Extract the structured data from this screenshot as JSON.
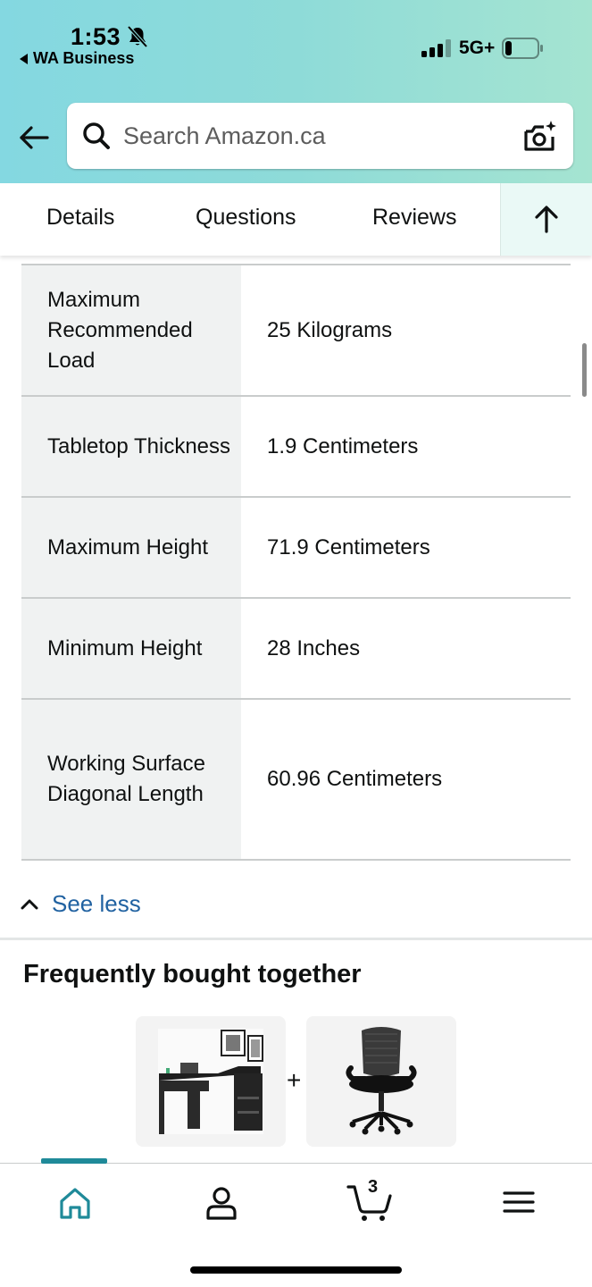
{
  "status_bar": {
    "time": "1:53",
    "back_app": "WA Business",
    "network": "5G+"
  },
  "search": {
    "placeholder": "Search Amazon.ca"
  },
  "tabs": [
    {
      "label": "Details"
    },
    {
      "label": "Questions"
    },
    {
      "label": "Reviews"
    }
  ],
  "specs": [
    {
      "key": "Maximum Recommended Load",
      "value": "25 Kilograms"
    },
    {
      "key": "Tabletop Thickness",
      "value": "1.9 Centimeters"
    },
    {
      "key": "Maximum Height",
      "value": "71.9 Centimeters"
    },
    {
      "key": "Minimum Height",
      "value": "28 Inches"
    },
    {
      "key": "Working Surface Diagonal Length",
      "value": "60.96 Centimeters"
    }
  ],
  "see_less_label": "See less",
  "frequently_bought": {
    "title": "Frequently bought together",
    "plus": "+",
    "items": [
      {
        "icon": "l-shaped-desk-image"
      },
      {
        "icon": "office-chair-image"
      }
    ]
  },
  "bottom_nav": {
    "items": [
      "home-icon",
      "account-icon",
      "cart-icon",
      "menu-icon"
    ],
    "cart_count": "3",
    "active": "home"
  },
  "colors": {
    "header_gradient_start": "#84d8e1",
    "header_gradient_end": "#a5e4d1",
    "link": "#2162a1",
    "active_nav": "#1f8a99",
    "spec_key_bg": "#f0f2f2"
  }
}
